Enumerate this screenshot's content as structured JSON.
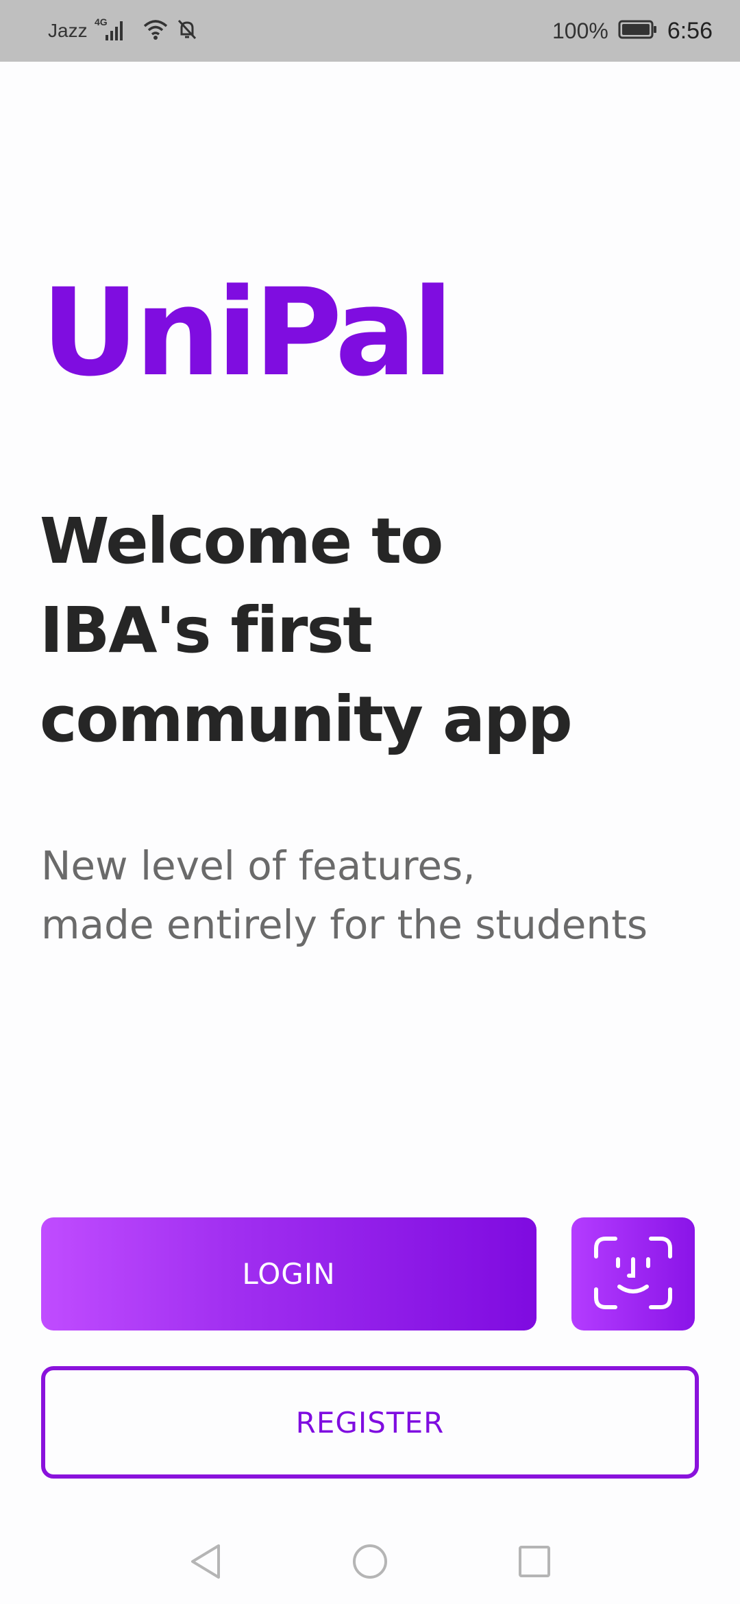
{
  "status_bar": {
    "carrier": "Jazz",
    "network_type": "4G",
    "battery_percent": "100%",
    "time": "6:56",
    "icons": [
      "signal-icon",
      "wifi-icon",
      "bell-off-icon",
      "battery-icon"
    ]
  },
  "app": {
    "logo_text": "UniPal",
    "brand_color": "#7f0de0"
  },
  "welcome": {
    "headline_lines": [
      "Welcome to",
      "IBA's first",
      "community app"
    ],
    "subtitle_lines": [
      "New level of features,",
      "made entirely for the students"
    ]
  },
  "actions": {
    "login_label": "LOGIN",
    "face_id_icon": "face-id-icon",
    "register_label": "REGISTER"
  },
  "nav_bar": {
    "icons": [
      "back-icon",
      "home-icon",
      "recents-icon"
    ]
  }
}
